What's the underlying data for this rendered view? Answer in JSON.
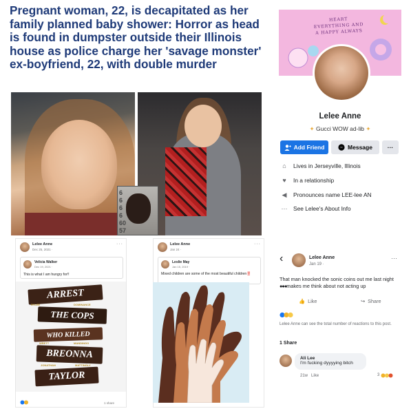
{
  "headline": "Pregnant woman, 22, is decapitated as her family planned baby shower: Horror as head is found in dumpster outside their Illinois house as police charge her 'savage monster' ex-boyfriend, 22, with double murder",
  "mugshot_numbers": [
    "6",
    "6",
    "6",
    "6",
    "60",
    "57"
  ],
  "profile": {
    "cover_text": "HEART EVERYTHING AND A HAPPY ALWAYS",
    "name": "Lelee Anne",
    "bio": "Gucci WOW ad-lib",
    "add_friend": "Add Friend",
    "message": "Message",
    "more": "···",
    "info": [
      {
        "icon": "house-icon",
        "text": "Lives in Jerseyville, Illinois"
      },
      {
        "icon": "heart-icon",
        "text": "In a relationship"
      },
      {
        "icon": "speaker-icon",
        "text": "Pronounces name LEE-lee AN"
      },
      {
        "icon": "ellipsis-icon",
        "text": "See Lelee's About Info"
      }
    ]
  },
  "post1": {
    "name": "Lelee Anne",
    "date": "Dec 25, 2021 · ",
    "more": "···",
    "shared_name": "Velicia Walker",
    "shared_date": "Dec 19, 2021 · ",
    "text": "This is what I am hungry for!!",
    "bars": [
      "ARREST",
      "THE COPS",
      "WHO KILLED",
      "BREONNA",
      "TAYLOR"
    ],
    "bar_small": [
      "RYLEE",
      "DOMINANCE",
      "WRETT",
      "MANDINGO",
      "JONATHAN",
      "MATTINGLY"
    ],
    "shares": "1 share"
  },
  "post2": {
    "name": "Lelee Anne",
    "date": "Jan 24 · ",
    "more": "···",
    "shared_name": "Leslie May",
    "shared_date": "Jan 15, 2019 · ",
    "text": "Mixed children are some of the most beautiful children",
    "text_emoji": "‼️"
  },
  "post3": {
    "back": "‹",
    "name": "Lelee Anne",
    "date": "Jan 19 · ",
    "more": "···",
    "text_a": "That man knocked the sonic coins out me last night",
    "text_b": "makes me think about not acting up",
    "like": "Like",
    "share": "Share",
    "reactions_note": "Lelee Anne can see the total number of reactions to this post.",
    "share_count": "1 Share",
    "comment_name": "Ali Lee",
    "comment_text": "I'm fucking dyyyying bitch",
    "comment_time": "21w",
    "comment_like": "Like",
    "comment_reacts": "3"
  }
}
